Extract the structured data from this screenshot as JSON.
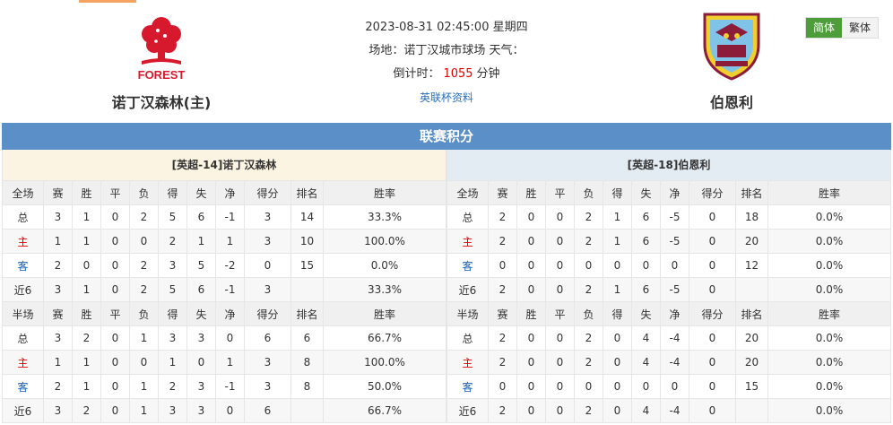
{
  "match": {
    "datetime": "2023-08-31 02:45:00 星期四",
    "venue_line": "场地：诺丁汉城市球场 天气：",
    "countdown_label": "倒计时：",
    "countdown_value": "1055",
    "countdown_unit": "分钟",
    "cup_link": "英联杯资料"
  },
  "home_team": {
    "name": "诺丁汉森林(主)",
    "logo_text": "FOREST"
  },
  "away_team": {
    "name": "伯恩利"
  },
  "lang": {
    "simplified": "简体",
    "traditional": "繁体"
  },
  "section_title": "联赛积分",
  "colors": {
    "header_blue": "#5b8fc7",
    "lang_active": "#4d9e3a",
    "home_panel": "#fcf4e2",
    "away_panel": "#e3ebf3"
  },
  "panels": {
    "home": {
      "title": "[英超-14]诺丁汉森林",
      "full": {
        "header": [
          "全场",
          "赛",
          "胜",
          "平",
          "负",
          "得",
          "失",
          "净",
          "得分",
          "排名",
          "胜率"
        ],
        "rows": [
          [
            "总",
            "3",
            "1",
            "0",
            "2",
            "5",
            "6",
            "-1",
            "3",
            "14",
            "33.3%"
          ],
          [
            "主",
            "1",
            "1",
            "0",
            "0",
            "2",
            "1",
            "1",
            "3",
            "10",
            "100.0%"
          ],
          [
            "客",
            "2",
            "0",
            "0",
            "2",
            "3",
            "5",
            "-2",
            "0",
            "15",
            "0.0%"
          ],
          [
            "近6",
            "3",
            "1",
            "0",
            "2",
            "5",
            "6",
            "-1",
            "3",
            "",
            "33.3%"
          ]
        ]
      },
      "half": {
        "header": [
          "半场",
          "赛",
          "胜",
          "平",
          "负",
          "得",
          "失",
          "净",
          "得分",
          "排名",
          "胜率"
        ],
        "rows": [
          [
            "总",
            "3",
            "2",
            "0",
            "1",
            "3",
            "3",
            "0",
            "6",
            "6",
            "66.7%"
          ],
          [
            "主",
            "1",
            "1",
            "0",
            "0",
            "1",
            "0",
            "1",
            "3",
            "8",
            "100.0%"
          ],
          [
            "客",
            "2",
            "1",
            "0",
            "1",
            "2",
            "3",
            "-1",
            "3",
            "8",
            "50.0%"
          ],
          [
            "近6",
            "3",
            "2",
            "0",
            "1",
            "3",
            "3",
            "0",
            "6",
            "",
            "66.7%"
          ]
        ]
      }
    },
    "away": {
      "title": "[英超-18]伯恩利",
      "full": {
        "header": [
          "全场",
          "赛",
          "胜",
          "平",
          "负",
          "得",
          "失",
          "净",
          "得分",
          "排名",
          "胜率"
        ],
        "rows": [
          [
            "总",
            "2",
            "0",
            "0",
            "2",
            "1",
            "6",
            "-5",
            "0",
            "18",
            "0.0%"
          ],
          [
            "主",
            "2",
            "0",
            "0",
            "2",
            "1",
            "6",
            "-5",
            "0",
            "20",
            "0.0%"
          ],
          [
            "客",
            "0",
            "0",
            "0",
            "0",
            "0",
            "0",
            "0",
            "0",
            "12",
            "0.0%"
          ],
          [
            "近6",
            "2",
            "0",
            "0",
            "2",
            "1",
            "6",
            "-5",
            "0",
            "",
            "0.0%"
          ]
        ]
      },
      "half": {
        "header": [
          "半场",
          "赛",
          "胜",
          "平",
          "负",
          "得",
          "失",
          "净",
          "得分",
          "排名",
          "胜率"
        ],
        "rows": [
          [
            "总",
            "2",
            "0",
            "0",
            "2",
            "0",
            "4",
            "-4",
            "0",
            "20",
            "0.0%"
          ],
          [
            "主",
            "2",
            "0",
            "0",
            "2",
            "0",
            "4",
            "-4",
            "0",
            "20",
            "0.0%"
          ],
          [
            "客",
            "0",
            "0",
            "0",
            "0",
            "0",
            "0",
            "0",
            "0",
            "15",
            "0.0%"
          ],
          [
            "近6",
            "2",
            "0",
            "0",
            "2",
            "0",
            "4",
            "-4",
            "0",
            "",
            "0.0%"
          ]
        ]
      }
    }
  }
}
